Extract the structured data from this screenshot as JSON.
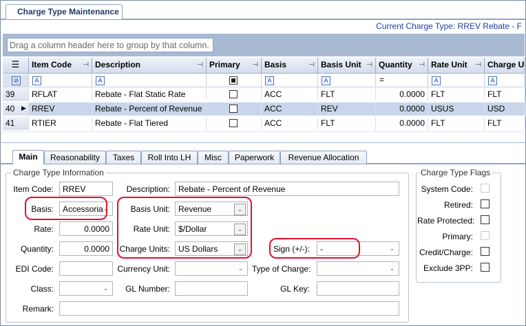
{
  "window": {
    "tab_title": "Charge Type Maintenance",
    "current_type": "Current Charge Type: RREV Rebate - F"
  },
  "grid": {
    "group_hint": "Drag a column header here to group by that column.",
    "columns": [
      "Item Code",
      "Description",
      "Primary",
      "Basis",
      "Basis Unit",
      "Quantity",
      "Rate Unit",
      "Charge Ur"
    ],
    "rows": [
      {
        "num": "39",
        "item": "RFLAT",
        "desc": "Rebate - Flat Static Rate",
        "basis": "ACC",
        "basis_unit": "FLT",
        "qty": "0.0000",
        "rate_unit": "FLT",
        "charge_unit": "FLT"
      },
      {
        "num": "40",
        "item": "RREV",
        "desc": "Rebate - Percent of Revenue",
        "basis": "ACC",
        "basis_unit": "REV",
        "qty": "0.0000",
        "rate_unit": "USUS",
        "charge_unit": "USD"
      },
      {
        "num": "41",
        "item": "RTIER",
        "desc": "Rebate - Flat Tiered",
        "basis": "ACC",
        "basis_unit": "FLT",
        "qty": "0.0000",
        "rate_unit": "FLT",
        "charge_unit": "FLT"
      }
    ]
  },
  "tabs": [
    "Main",
    "Reasonability",
    "Taxes",
    "Roll Into LH",
    "Misc",
    "Paperwork",
    "Revenue Allocation"
  ],
  "form": {
    "group_title": "Charge Type Information",
    "item_code_label": "Item Code:",
    "item_code": "RREV",
    "description_label": "Description:",
    "description": "Rebate - Percent of Revenue",
    "basis_label": "Basis:",
    "basis": "Accessoria",
    "basis_unit_label": "Basis Unit:",
    "basis_unit": "Revenue",
    "rate_label": "Rate:",
    "rate": "0.0000",
    "rate_unit_label": "Rate Unit:",
    "rate_unit": "$/Dollar",
    "quantity_label": "Quantity:",
    "quantity": "0.0000",
    "charge_units_label": "Charge Units:",
    "charge_units": "US Dollars",
    "sign_label": "Sign (+/-):",
    "sign": "-",
    "edi_label": "EDI Code:",
    "currency_label": "Currency Unit:",
    "type_label": "Type of Charge:",
    "class_label": "Class:",
    "gl_number_label": "GL Number:",
    "gl_key_label": "GL Key:",
    "remark_label": "Remark:"
  },
  "flags": {
    "title": "Charge Type Flags",
    "items": [
      {
        "label": "System Code:",
        "checked": false,
        "enabled": false
      },
      {
        "label": "Retired:",
        "checked": false,
        "enabled": true
      },
      {
        "label": "Rate Protected:",
        "checked": false,
        "enabled": true
      },
      {
        "label": "Primary:",
        "checked": false,
        "enabled": false
      },
      {
        "label": "Credit/Charge:",
        "checked": false,
        "enabled": true
      },
      {
        "label": "Exclude 3PP:",
        "checked": false,
        "enabled": true
      }
    ]
  },
  "colors": {
    "highlight": "#e0102a",
    "selected_row": "#c9d6ea",
    "link": "#1a3da8"
  }
}
